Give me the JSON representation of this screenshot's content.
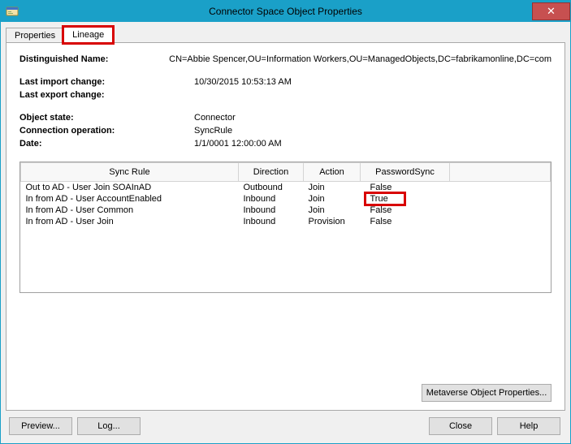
{
  "window": {
    "title": "Connector Space Object Properties"
  },
  "tabs": {
    "items": [
      {
        "label": "Properties"
      },
      {
        "label": "Lineage"
      }
    ],
    "active": 1,
    "highlighted": 1
  },
  "info": {
    "dn_label": "Distinguished Name:",
    "dn_value": "CN=Abbie Spencer,OU=Information Workers,OU=ManagedObjects,DC=fabrikamonline,DC=com",
    "last_import_label": "Last import change:",
    "last_import_value": "10/30/2015 10:53:13 AM",
    "last_export_label": "Last export change:",
    "last_export_value": "",
    "object_state_label": "Object state:",
    "object_state_value": "Connector",
    "conn_op_label": "Connection operation:",
    "conn_op_value": "SyncRule",
    "date_label": "Date:",
    "date_value": "1/1/0001 12:00:00 AM"
  },
  "rules": {
    "headers": {
      "rule": "Sync Rule",
      "direction": "Direction",
      "action": "Action",
      "password": "PasswordSync"
    },
    "rows": [
      {
        "rule": "Out to AD - User Join SOAInAD",
        "direction": "Outbound",
        "action": "Join",
        "password": "False",
        "highlight": false
      },
      {
        "rule": "In from AD - User AccountEnabled",
        "direction": "Inbound",
        "action": "Join",
        "password": "True",
        "highlight": true
      },
      {
        "rule": "In from AD - User Common",
        "direction": "Inbound",
        "action": "Join",
        "password": "False",
        "highlight": false
      },
      {
        "rule": "In from AD - User Join",
        "direction": "Inbound",
        "action": "Provision",
        "password": "False",
        "highlight": false
      }
    ]
  },
  "buttons": {
    "metaverse": "Metaverse Object Properties...",
    "preview": "Preview...",
    "log": "Log...",
    "close": "Close",
    "help": "Help"
  }
}
